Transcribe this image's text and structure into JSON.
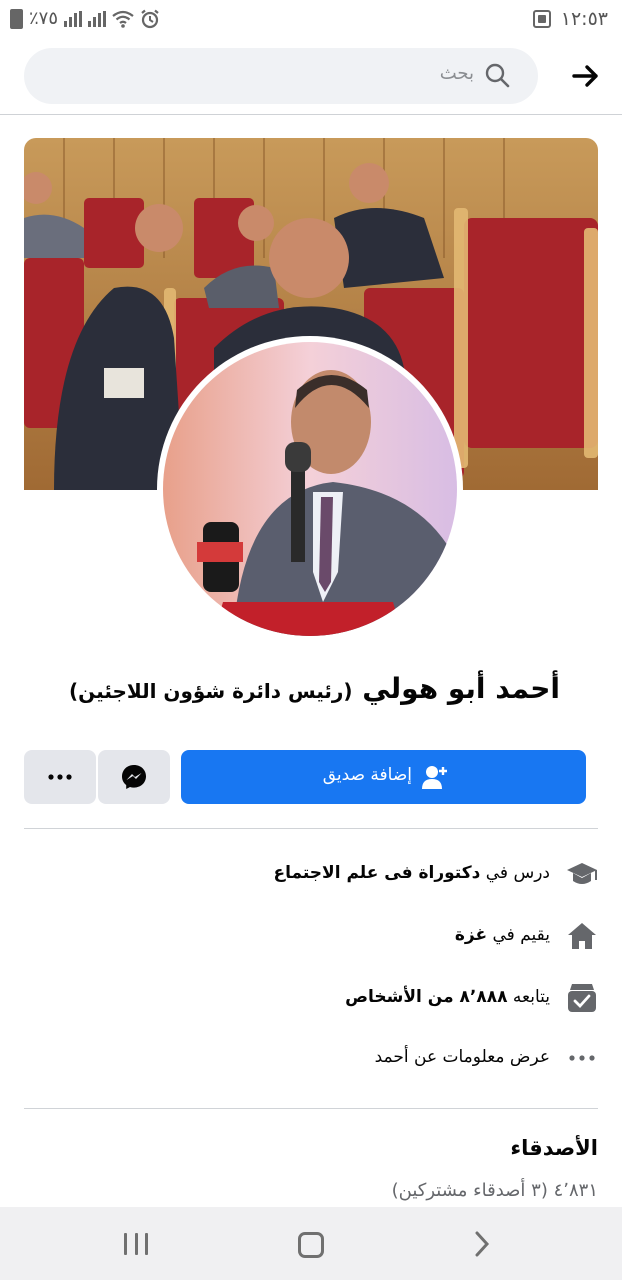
{
  "status_bar": {
    "time": "١٢:٥٣",
    "battery": "٧٥٪"
  },
  "search": {
    "placeholder": "بحث"
  },
  "profile": {
    "name": "أحمد أبو هولي",
    "title": "(رئيس دائرة شؤون اللاجئين)"
  },
  "actions": {
    "add_friend_label": "إضافة صديق"
  },
  "intro": {
    "education_prefix": "درس في",
    "education_value": "دكتوراة فى علم الاجتماع",
    "lives_prefix": "يقيم في",
    "lives_value": "غزة",
    "followers_prefix": "يتابعه",
    "followers_value": "٨٬٨٨٨ من الأشخاص",
    "more_info": "عرض معلومات عن أحمد"
  },
  "friends": {
    "title": "الأصدقاء",
    "count": "٤٬٨٣١",
    "mutual": "(٣ أصدقاء مشتركين)"
  },
  "colors": {
    "primary": "#1877f2",
    "button_gray": "#e4e6eb",
    "search_bg": "#f0f2f5"
  }
}
